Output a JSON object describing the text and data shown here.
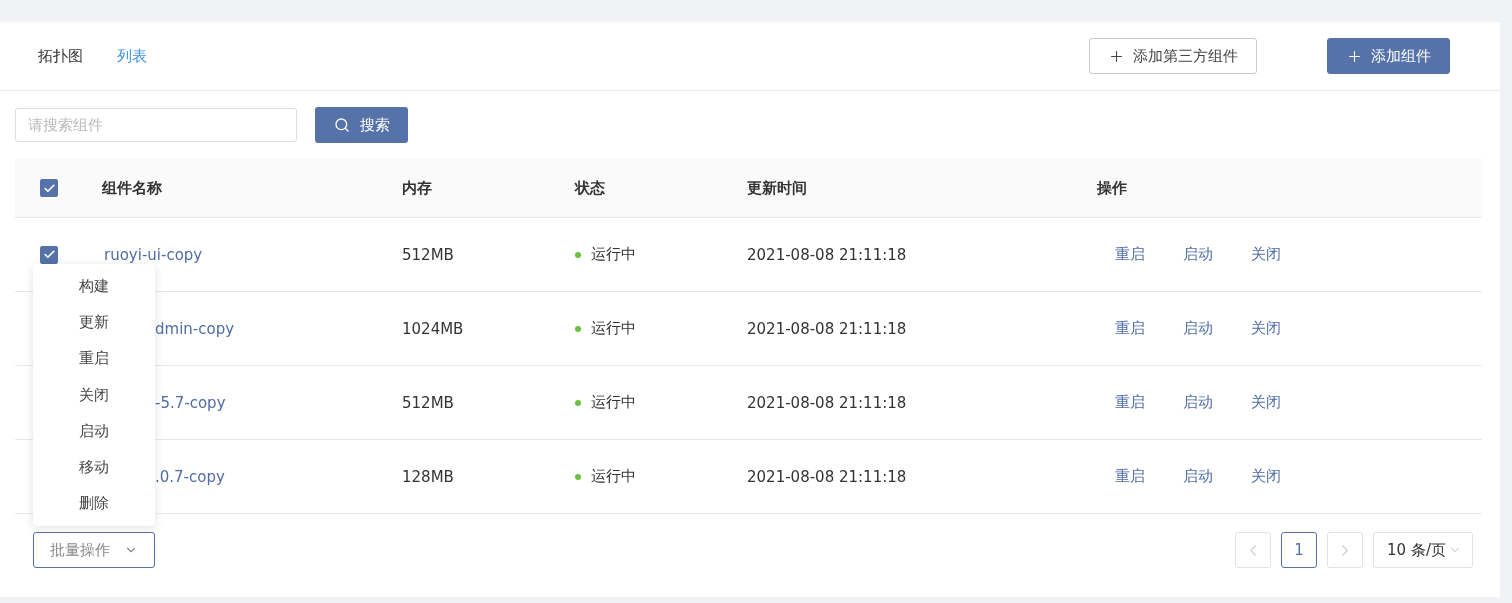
{
  "tabs": [
    {
      "label": "拓扑图",
      "selected": false
    },
    {
      "label": "列表",
      "selected": true
    }
  ],
  "header_buttons": [
    {
      "label": "添加第三方组件",
      "kind": "outline"
    },
    {
      "label": "添加组件",
      "kind": "primary"
    }
  ],
  "search": {
    "placeholder": "请搜索组件",
    "button": "搜索"
  },
  "table": {
    "select_all_checked": true,
    "columns": [
      "组件名称",
      "内存",
      "状态",
      "更新时间",
      "操作"
    ],
    "rows": [
      {
        "checked": true,
        "name": "ruoyi-ui-copy",
        "name_hidden": false,
        "memory": "512MB",
        "status": "运行中",
        "updated": "2021-08-08 21:11:18",
        "actions": [
          "重启",
          "启动",
          "关闭"
        ]
      },
      {
        "name": "dmin-copy",
        "name_hidden": true,
        "memory": "1024MB",
        "status": "运行中",
        "updated": "2021-08-08 21:11:18",
        "actions": [
          "重启",
          "启动",
          "关闭"
        ]
      },
      {
        "name": "-5.7-copy",
        "name_hidden": true,
        "memory": "512MB",
        "status": "运行中",
        "updated": "2021-08-08 21:11:18",
        "actions": [
          "重启",
          "启动",
          "关闭"
        ]
      },
      {
        "name": ".0.7-copy",
        "name_hidden": true,
        "memory": "128MB",
        "status": "运行中",
        "updated": "2021-08-08 21:11:18",
        "actions": [
          "重启",
          "启动",
          "关闭"
        ]
      }
    ]
  },
  "batch_menu": {
    "label": "批量操作",
    "expanded": true,
    "items": [
      "构建",
      "更新",
      "重启",
      "关闭",
      "启动",
      "移动",
      "删除"
    ]
  },
  "pagination": {
    "prev_disabled": true,
    "next_disabled": true,
    "pages": [
      {
        "label": "1",
        "selected": true
      }
    ],
    "page_size": "10 条/页"
  }
}
